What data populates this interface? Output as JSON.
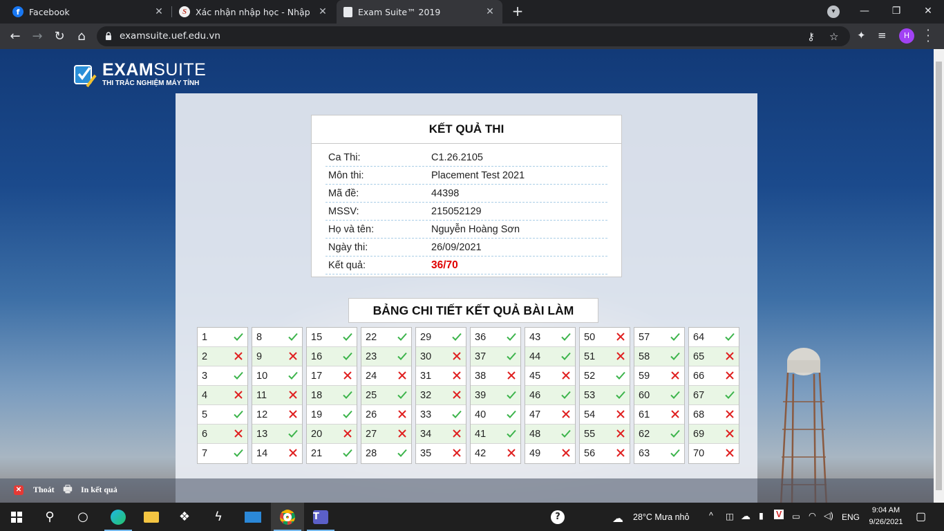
{
  "browser": {
    "tabs": [
      {
        "title": "Facebook",
        "icon": "facebook-icon"
      },
      {
        "title": "Xác nhận nhập học - Nhập học Tr",
        "icon": "uef-s-icon"
      },
      {
        "title": "Exam Suite™ 2019",
        "icon": "page-icon",
        "active": true
      }
    ],
    "url": "examsuite.uef.edu.vn",
    "profile_initial": "H"
  },
  "logo": {
    "brand_bold": "EXAM",
    "brand_light": "SUITE",
    "tagline": "THI TRẮC NGHIỆM MÁY TÍNH"
  },
  "result": {
    "heading": "KẾT QUẢ THI",
    "rows": [
      {
        "label": "Ca Thi:",
        "value": "C1.26.2105"
      },
      {
        "label": "Môn thi:",
        "value": "Placement Test 2021"
      },
      {
        "label": "Mã đề:",
        "value": "44398"
      },
      {
        "label": "MSSV:",
        "value": "215052129"
      },
      {
        "label": "Họ và tên:",
        "value": "Nguyễn Hoàng Sơn"
      },
      {
        "label": "Ngày thi:",
        "value": "26/09/2021"
      },
      {
        "label": "Kết quả:",
        "value": "36/70"
      }
    ]
  },
  "detail": {
    "heading": "BẢNG CHI TIẾT KẾT QUẢ BÀI LÀM",
    "answers": [
      true,
      false,
      true,
      false,
      true,
      false,
      true,
      true,
      false,
      true,
      false,
      false,
      true,
      false,
      true,
      true,
      false,
      true,
      true,
      false,
      true,
      true,
      true,
      false,
      true,
      false,
      false,
      true,
      true,
      false,
      false,
      false,
      true,
      false,
      false,
      true,
      true,
      false,
      true,
      true,
      true,
      false,
      true,
      true,
      false,
      true,
      false,
      true,
      false,
      false,
      false,
      true,
      true,
      false,
      false,
      false,
      true,
      true,
      false,
      true,
      false,
      true,
      true,
      true,
      false,
      false,
      true,
      false,
      false,
      false
    ]
  },
  "actions": {
    "exit": "Thoát",
    "print": "In kết quả"
  },
  "taskbar": {
    "weather": "28°C  Mưa nhỏ",
    "lang": "ENG",
    "time": "9:04 AM",
    "date": "9/26/2021"
  },
  "colors": {
    "correct": "#3cb44b",
    "wrong": "#e02020",
    "score": "#e00000"
  }
}
